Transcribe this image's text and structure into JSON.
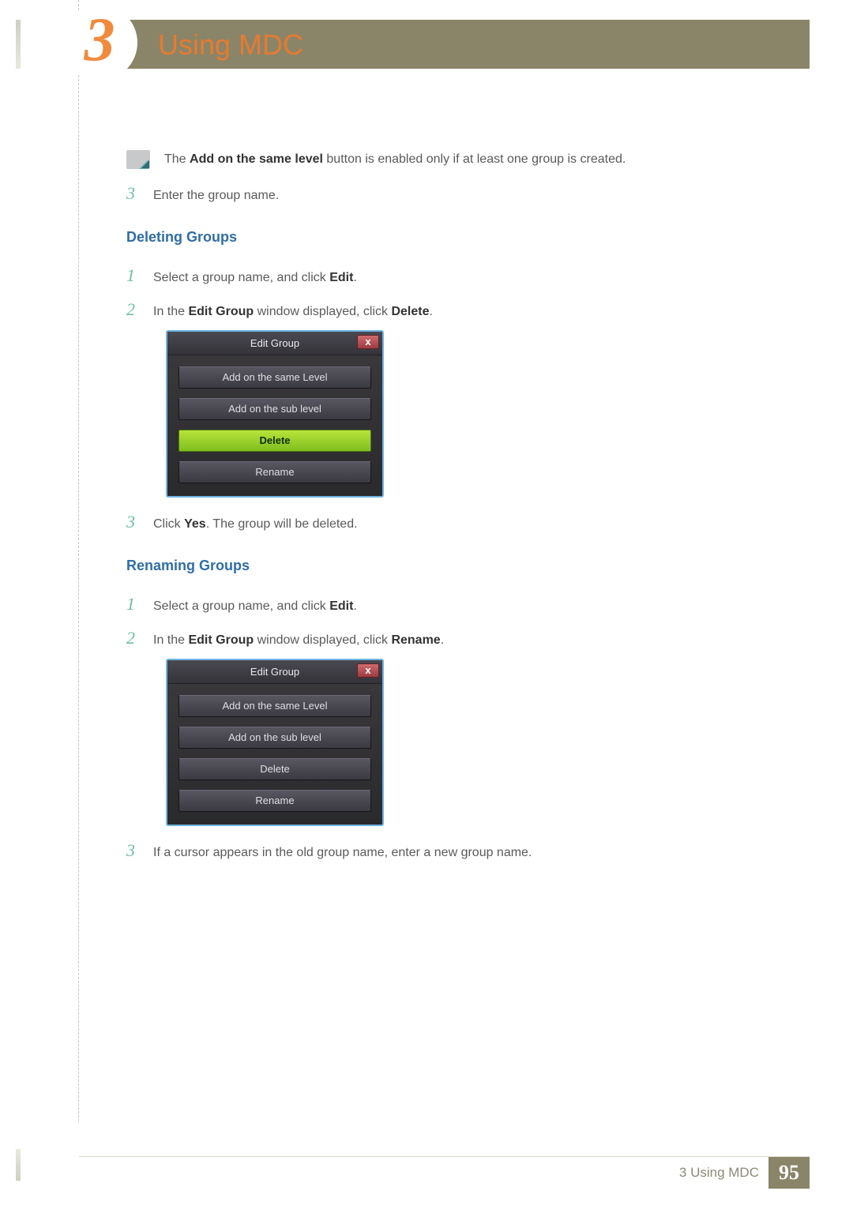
{
  "chapter": {
    "number": "3",
    "title": "Using MDC"
  },
  "note": {
    "prefix": "The ",
    "bold": "Add on the same level",
    "suffix": " button is enabled only if at least one group is created."
  },
  "step0": {
    "num": "3",
    "text": "Enter the group name."
  },
  "sec1": {
    "heading": "Deleting Groups",
    "s1": {
      "num": "1",
      "pre": "Select a group name, and click ",
      "b": "Edit",
      "post": "."
    },
    "s2": {
      "num": "2",
      "pre": "In the ",
      "b1": "Edit Group",
      "mid": " window displayed, click ",
      "b2": "Delete",
      "post": "."
    },
    "s3": {
      "num": "3",
      "pre": "Click ",
      "b": "Yes",
      "post": ". The group will be deleted."
    }
  },
  "sec2": {
    "heading": "Renaming Groups",
    "s1": {
      "num": "1",
      "pre": "Select a group name, and click ",
      "b": "Edit",
      "post": "."
    },
    "s2": {
      "num": "2",
      "pre": "In the ",
      "b1": "Edit Group",
      "mid": " window displayed, click ",
      "b2": "Rename",
      "post": "."
    },
    "s3": {
      "num": "3",
      "text": "If a cursor appears in the old group name, enter a new group name."
    }
  },
  "dialog": {
    "title": "Edit Group",
    "close": "x",
    "btn_same": "Add on the same Level",
    "btn_sub": "Add on the sub level",
    "btn_delete": "Delete",
    "btn_rename": "Rename"
  },
  "footer": {
    "text": "3 Using MDC",
    "page": "95"
  }
}
